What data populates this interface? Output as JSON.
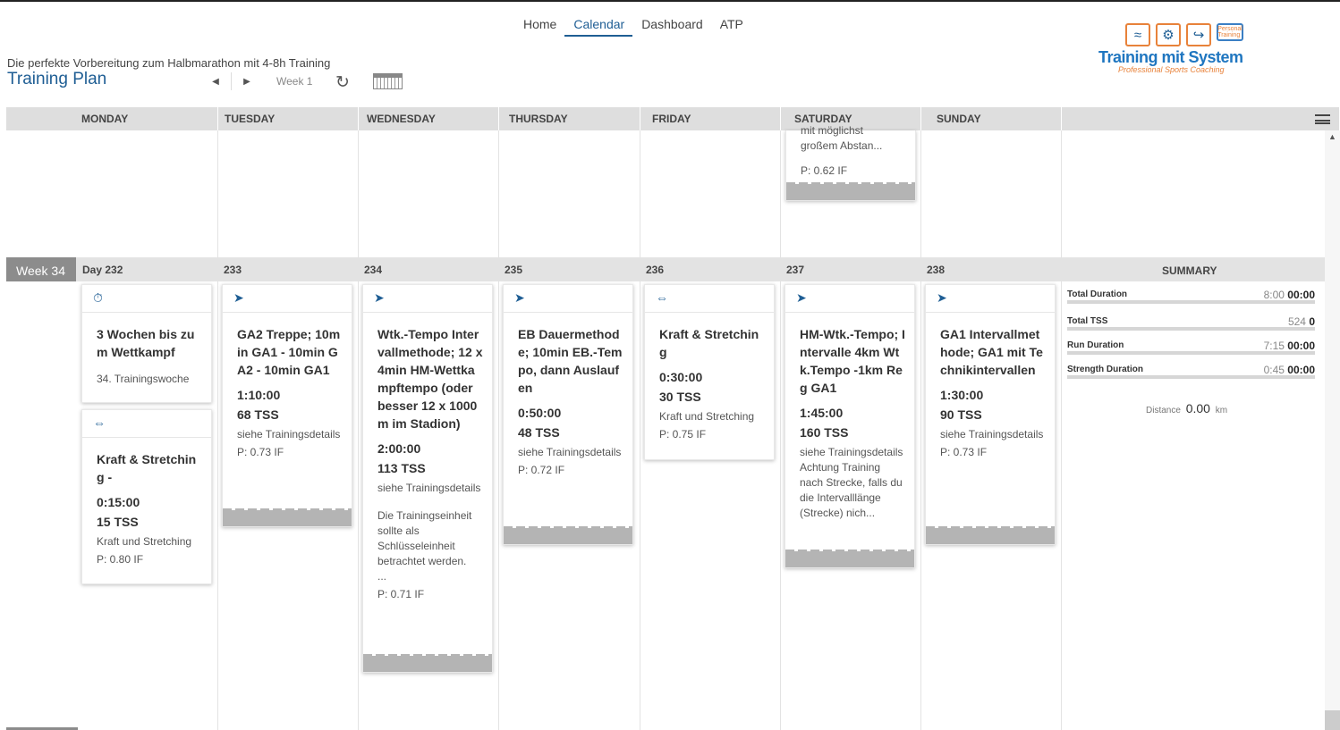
{
  "nav": {
    "items": [
      "Home",
      "Calendar",
      "Dashboard",
      "ATP"
    ],
    "active": "Calendar"
  },
  "header": {
    "subtitle": "Die perfekte Vorbereitung zum Halbmarathon mit 4-8h Training",
    "title": "Training Plan",
    "week_label": "Week 1"
  },
  "logo": {
    "text": "Training mit System",
    "tagline": "Professional Sports Coaching",
    "badge": "Personal Training"
  },
  "days": [
    "MONDAY",
    "TUESDAY",
    "WEDNESDAY",
    "THURSDAY",
    "FRIDAY",
    "SATURDAY",
    "SUNDAY"
  ],
  "prev_week_card": {
    "desc": "mit möglichst\ngroßem Abstan...",
    "if": "P: 0.62 IF"
  },
  "week": {
    "label": "Week 34",
    "day_numbers": [
      "Day 232",
      "233",
      "234",
      "235",
      "236",
      "237",
      "238"
    ],
    "summary_title": "SUMMARY"
  },
  "cards": {
    "mon_event": {
      "icon": "stopwatch-icon",
      "title": "3 Wochen bis zum Wettkampf",
      "desc": "34. Trainingswoche"
    },
    "mon_strength": {
      "icon": "dumbbell-icon",
      "title": "Kraft & Stretching -",
      "duration": "0:15:00",
      "tss": "15 TSS",
      "desc": "Kraft und Stretching",
      "if": "P: 0.80 IF"
    },
    "tue": {
      "icon": "shoe-icon",
      "title": "GA2 Treppe; 10min GA1 - 10min GA2 - 10min GA1",
      "duration": "1:10:00",
      "tss": "68 TSS",
      "desc": "siehe Trainingsdetails",
      "if": "P: 0.73 IF"
    },
    "wed": {
      "icon": "shoe-icon",
      "title": "Wtk.-Tempo Intervallmethode; 12 x 4min HM-Wettkampftempo (oder besser 12 x 1000m im Stadion)",
      "duration": "2:00:00",
      "tss": "113 TSS",
      "desc": "siehe Trainingsdetails",
      "extra": "Die Trainingseinheit sollte als Schlüsseleinheit betrachtet werden.\n...",
      "if": "P: 0.71 IF"
    },
    "thu": {
      "icon": "shoe-icon",
      "title": "EB Dauermethode; 10min EB.-Tempo, dann Auslaufen",
      "duration": "0:50:00",
      "tss": "48 TSS",
      "desc": "siehe Trainingsdetails",
      "if": "P: 0.72 IF"
    },
    "fri": {
      "icon": "dumbbell-icon",
      "title": "Kraft & Stretching",
      "duration": "0:30:00",
      "tss": "30 TSS",
      "desc": "Kraft und Stretching",
      "if": "P: 0.75 IF"
    },
    "sat": {
      "icon": "shoe-icon",
      "title": "HM-Wtk.-Tempo; Intervalle 4km Wtk.Tempo -1km Reg GA1",
      "duration": "1:45:00",
      "tss": "160 TSS",
      "desc": "siehe Trainingsdetails Achtung Training nach Strecke, falls du die Intervalllänge (Strecke) nich..."
    },
    "sun": {
      "icon": "shoe-icon",
      "title": "GA1 Intervallmethode; GA1 mit Technikintervallen",
      "duration": "1:30:00",
      "tss": "90 TSS",
      "desc": "siehe Trainingsdetails",
      "if": "P: 0.73 IF"
    }
  },
  "summary": [
    {
      "label": "Total Duration",
      "planned": "8:00",
      "done": "00:00"
    },
    {
      "label": "Total TSS",
      "planned": "524",
      "done": "0"
    },
    {
      "label": "Run Duration",
      "planned": "7:15",
      "done": "00:00"
    },
    {
      "label": "Strength Duration",
      "planned": "0:45",
      "done": "00:00"
    }
  ],
  "distance": {
    "label": "Distance",
    "value": "0.00",
    "unit": "km"
  },
  "colors": {
    "accent": "#1f5e94",
    "header_bg": "#dedede",
    "week_badge": "#8c8c8c",
    "logo_orange": "#e8823a"
  }
}
